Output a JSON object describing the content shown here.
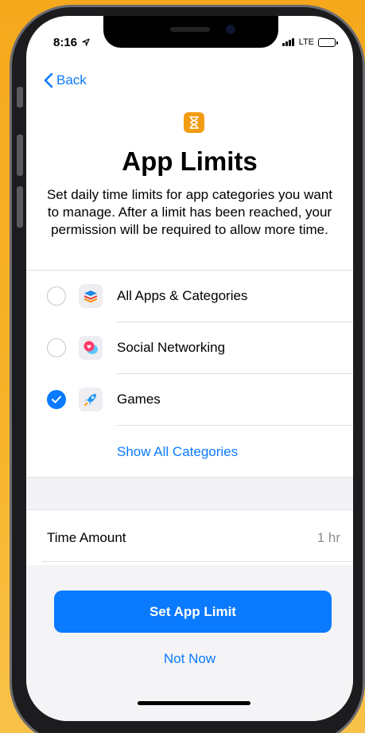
{
  "status_bar": {
    "time": "8:16",
    "location_icon": "location-arrow-icon",
    "network": "LTE"
  },
  "nav": {
    "back_label": "Back"
  },
  "header": {
    "icon": "hourglass-icon",
    "title": "App Limits",
    "description": "Set daily time limits for app categories you want to manage. After a limit has been reached, your permission will be required to allow more time."
  },
  "categories": [
    {
      "label": "All Apps & Categories",
      "icon": "stack-icon",
      "selected": false
    },
    {
      "label": "Social Networking",
      "icon": "chat-heart-icon",
      "selected": false
    },
    {
      "label": "Games",
      "icon": "rocket-icon",
      "selected": true
    }
  ],
  "show_all_label": "Show All Categories",
  "time_amount": {
    "label": "Time Amount",
    "value": "1 hr"
  },
  "actions": {
    "primary_label": "Set App Limit",
    "secondary_label": "Not Now"
  },
  "colors": {
    "accent": "#0a7aff",
    "background": "#f5a81c",
    "hero_icon": "#f39c12"
  }
}
